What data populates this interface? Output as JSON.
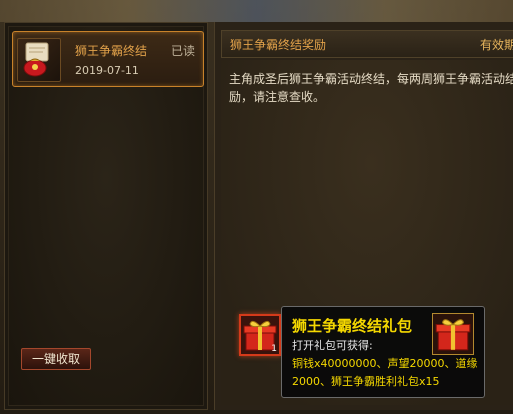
{
  "mail_list": {
    "items": [
      {
        "title": "狮王争霸终结",
        "status": "已读",
        "date": "2019-07-11",
        "icon": "scroll-redbag-icon"
      }
    ],
    "claim_all_label": "一键收取"
  },
  "mail_detail": {
    "title": "狮王争霸终结奖励",
    "validity_label": "有效期",
    "content": "主角成圣后狮王争霸活动终结，每两周狮王争霸活动结励，请注意查收。",
    "attachment": {
      "icon": "gift-box-icon",
      "count": "1"
    }
  },
  "tooltip": {
    "name": "狮王争霸终结礼包",
    "line1": "打开礼包可获得:",
    "line2": "铜钱x40000000、声望20000、道缘",
    "line3": "2000、狮王争霸胜利礼包x15",
    "icon": "gift-box-icon"
  },
  "colors": {
    "highlight_orange": "#e2a24a",
    "tooltip_yellow": "#f5d800",
    "attachment_border": "#d43a1a"
  }
}
